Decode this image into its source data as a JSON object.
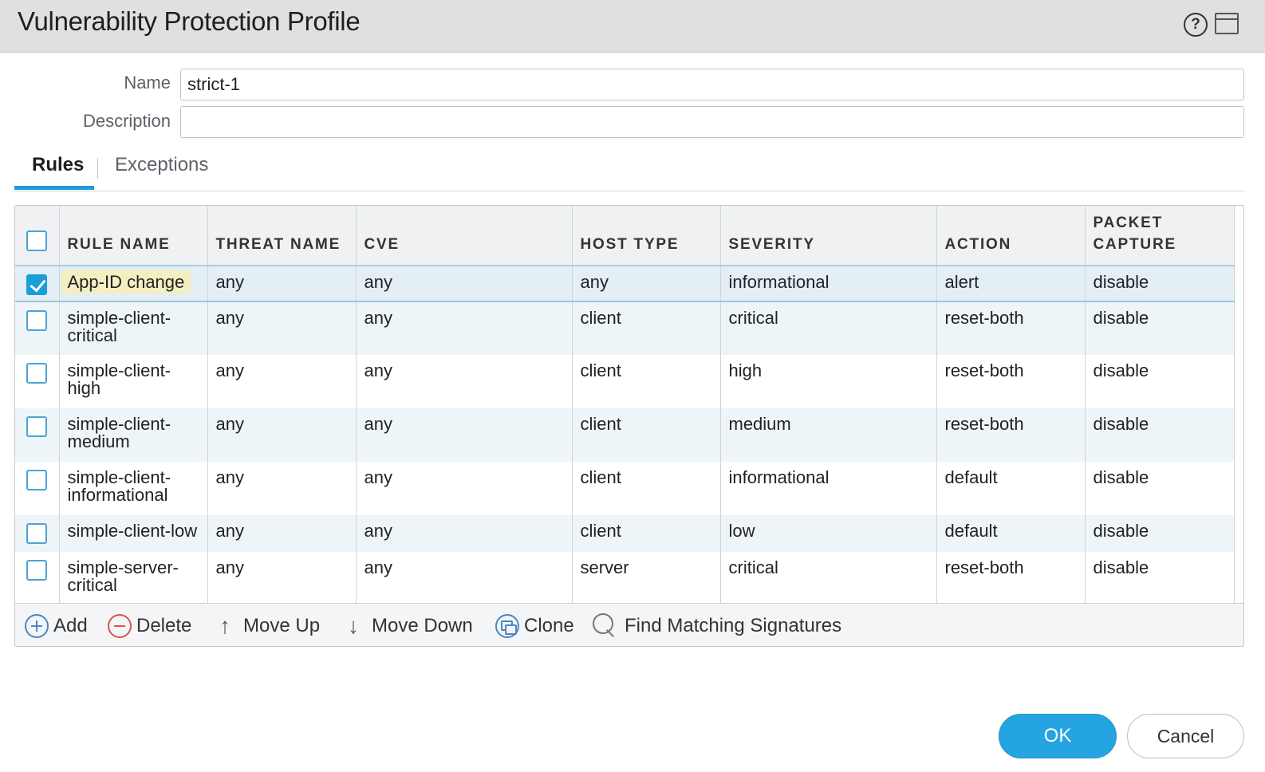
{
  "dialog": {
    "title": "Vulnerability Protection Profile",
    "help_icon": "help-icon",
    "maximize_icon": "maximize-icon"
  },
  "form": {
    "name_label": "Name",
    "name_value": "strict-1",
    "description_label": "Description",
    "description_value": ""
  },
  "tabs": [
    {
      "label": "Rules",
      "active": true
    },
    {
      "label": "Exceptions",
      "active": false
    }
  ],
  "table": {
    "columns": [
      "RULE NAME",
      "THREAT NAME",
      "CVE",
      "HOST TYPE",
      "SEVERITY",
      "ACTION",
      "PACKET CAPTURE"
    ],
    "header_checkbox_checked": false,
    "rows": [
      {
        "checked": true,
        "selected": true,
        "rule_name": "App-ID change",
        "threat_name": "any",
        "cve": "any",
        "host_type": "any",
        "severity": "informational",
        "action": "alert",
        "packet_capture": "disable"
      },
      {
        "checked": false,
        "selected": false,
        "rule_name": "simple-client-critical",
        "threat_name": "any",
        "cve": "any",
        "host_type": "client",
        "severity": "critical",
        "action": "reset-both",
        "packet_capture": "disable"
      },
      {
        "checked": false,
        "selected": false,
        "rule_name": "simple-client-high",
        "threat_name": "any",
        "cve": "any",
        "host_type": "client",
        "severity": "high",
        "action": "reset-both",
        "packet_capture": "disable"
      },
      {
        "checked": false,
        "selected": false,
        "rule_name": "simple-client-medium",
        "threat_name": "any",
        "cve": "any",
        "host_type": "client",
        "severity": "medium",
        "action": "reset-both",
        "packet_capture": "disable"
      },
      {
        "checked": false,
        "selected": false,
        "rule_name": "simple-client-informational",
        "threat_name": "any",
        "cve": "any",
        "host_type": "client",
        "severity": "informational",
        "action": "default",
        "packet_capture": "disable"
      },
      {
        "checked": false,
        "selected": false,
        "rule_name": "simple-client-low",
        "threat_name": "any",
        "cve": "any",
        "host_type": "client",
        "severity": "low",
        "action": "default",
        "packet_capture": "disable"
      },
      {
        "checked": false,
        "selected": false,
        "rule_name": "simple-server-critical",
        "threat_name": "any",
        "cve": "any",
        "host_type": "server",
        "severity": "critical",
        "action": "reset-both",
        "packet_capture": "disable"
      }
    ]
  },
  "toolbar": {
    "add_label": "Add",
    "delete_label": "Delete",
    "move_up_label": "Move Up",
    "move_down_label": "Move Down",
    "clone_label": "Clone",
    "find_label": "Find Matching Signatures"
  },
  "footer": {
    "ok_label": "OK",
    "cancel_label": "Cancel"
  },
  "colors": {
    "accent": "#1a9ed9",
    "ok_button": "#24a4e0",
    "delete": "#d9534f",
    "highlight": "#f4efc3"
  }
}
